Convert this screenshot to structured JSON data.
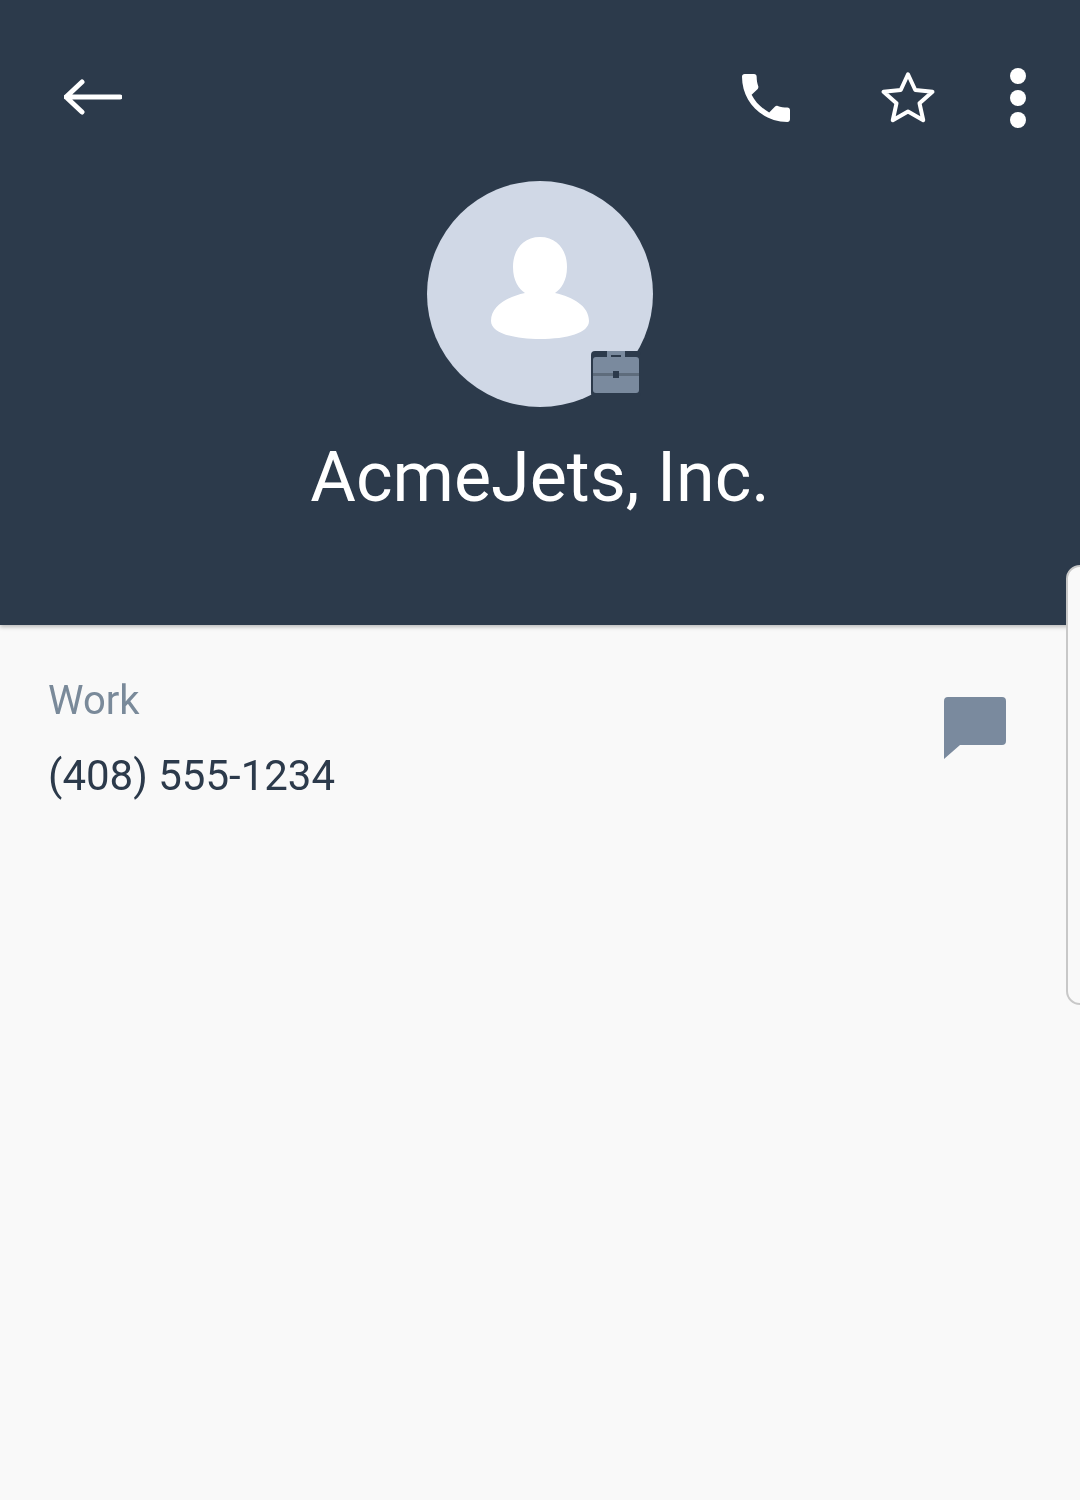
{
  "toolbar": {
    "favorite": false
  },
  "contact": {
    "name": "AcmeJets, Inc.",
    "work_profile": true
  },
  "numbers": [
    {
      "label": "Work",
      "number": "(408) 555-1234"
    }
  ]
}
